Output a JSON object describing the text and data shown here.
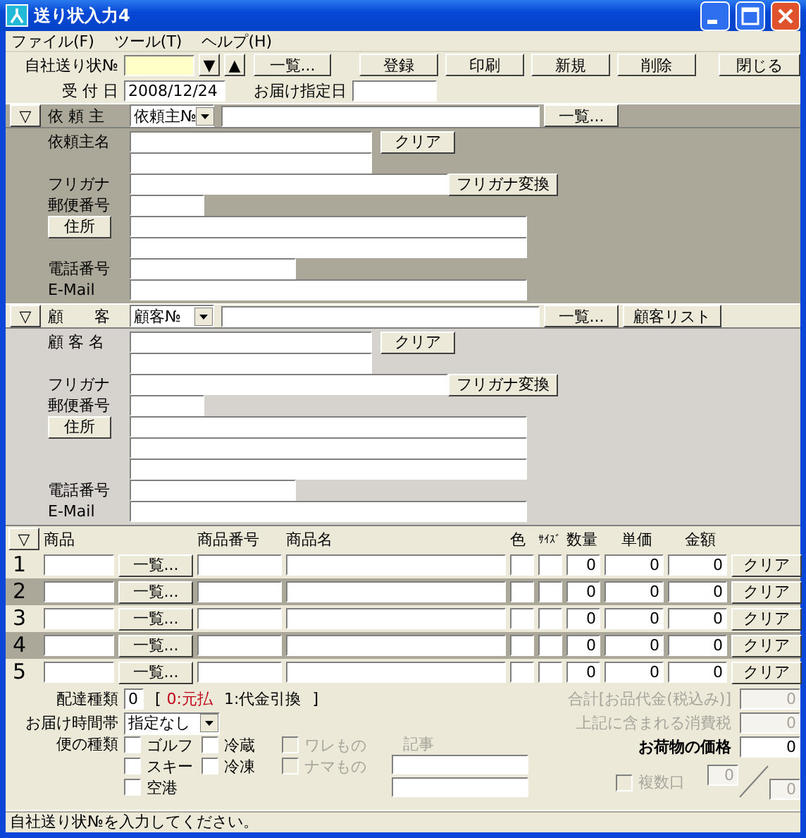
{
  "window": {
    "title": "送り状入力4"
  },
  "menu": [
    "ファイル(F)",
    "ツール(T)",
    "ヘルプ(H)"
  ],
  "toolbar": {
    "invoice_label": "自社送り状№",
    "invoice_field": {
      "focused": true
    },
    "nav_buttons": [
      "▼",
      "▲"
    ],
    "list_button": "一覧...",
    "actions": [
      "登録",
      "印刷",
      "新規",
      "削除"
    ],
    "close_button": "閉じる",
    "receipt_label": "受 付 日",
    "receipt_date": "2008/12/24",
    "delivery_date_label": "お届け指定日"
  },
  "sections": [
    {
      "kind": "sender",
      "toggle": "▽",
      "title": "依 頼 主",
      "select": "依頼主№",
      "list_button": "一覧...",
      "fields": [
        {
          "kind": "name",
          "label": "依頼主名",
          "button": "クリア"
        },
        {
          "kind": "furigana",
          "label": "フリガナ",
          "button": "フリガナ変換"
        },
        {
          "kind": "zip",
          "label": "郵便番号"
        },
        {
          "kind": "address",
          "button": "住所"
        },
        {
          "kind": "line"
        },
        {
          "kind": "phone",
          "label": "電話番号"
        },
        {
          "kind": "email",
          "label": "E-Mail"
        }
      ]
    },
    {
      "kind": "customer",
      "toggle": "▽",
      "title": "顧　　客",
      "select": "顧客№",
      "list_button": "一覧...",
      "extra_button": "顧客リスト",
      "fields": [
        {
          "kind": "name",
          "label": "顧 客 名",
          "button": "クリア"
        },
        {
          "kind": "furigana",
          "label": "フリガナ",
          "button": "フリガナ変換"
        },
        {
          "kind": "zip",
          "label": "郵便番号"
        },
        {
          "kind": "address",
          "button": "住所"
        },
        {
          "kind": "line"
        },
        {
          "kind": "line"
        },
        {
          "kind": "phone",
          "label": "電話番号"
        },
        {
          "kind": "email",
          "label": "E-Mail"
        }
      ]
    }
  ],
  "items": {
    "toggle": "▽",
    "columns": [
      "商品",
      "商品番号",
      "商品名",
      "色",
      "ｻｲｽﾞ",
      "数量",
      "単価",
      "金額"
    ],
    "rows": [
      {
        "number": "1",
        "list_button": "一覧...",
        "quantity": "0",
        "unit_price": "0",
        "amount": "0",
        "clear_button": "クリア",
        "shaded": false
      },
      {
        "number": "2",
        "list_button": "一覧...",
        "quantity": "0",
        "unit_price": "0",
        "amount": "0",
        "clear_button": "クリア",
        "shaded": true
      },
      {
        "number": "3",
        "list_button": "一覧...",
        "quantity": "0",
        "unit_price": "0",
        "amount": "0",
        "clear_button": "クリア",
        "shaded": false
      },
      {
        "number": "4",
        "list_button": "一覧...",
        "quantity": "0",
        "unit_price": "0",
        "amount": "0",
        "clear_button": "クリア",
        "shaded": true
      },
      {
        "number": "5",
        "list_button": "一覧...",
        "quantity": "0",
        "unit_price": "0",
        "amount": "0",
        "clear_button": "クリア",
        "shaded": false
      }
    ]
  },
  "delivery": {
    "type_label": "配達種類",
    "type_value": "0",
    "bracket_open": "[",
    "options": [
      {
        "text": "0:元払",
        "selected": true
      },
      {
        "text": "1:代金引換",
        "selected": false
      }
    ],
    "bracket_close": "]",
    "time_label": "お届け時間帯",
    "time_value": "指定なし"
  },
  "service": {
    "label": "便の種類",
    "options": [
      {
        "label": "ゴルフ",
        "checked": false,
        "disabled": false
      },
      {
        "label": "冷蔵",
        "checked": false,
        "disabled": false
      },
      {
        "label": "ワレもの",
        "checked": false,
        "disabled": true
      },
      {
        "label": "スキー",
        "checked": false,
        "disabled": false
      },
      {
        "label": "冷凍",
        "checked": false,
        "disabled": false
      },
      {
        "label": "ナマもの",
        "checked": false,
        "disabled": true
      },
      {
        "label": "空港",
        "checked": false,
        "disabled": false
      }
    ]
  },
  "memo": {
    "label": "記事",
    "disabled": true
  },
  "totals": [
    {
      "label": "合計[お品代金(税込み)]",
      "value": "0",
      "disabled": true
    },
    {
      "label": "上記に含まれる消費税",
      "value": "0",
      "disabled": true
    },
    {
      "label": "お荷物の価格",
      "value": "0",
      "disabled": false
    }
  ],
  "multiple": {
    "label": "複数口",
    "checked": false,
    "disabled": true,
    "count": "0",
    "total": "0"
  },
  "status_bar": "自社送り状№を入力してください。"
}
